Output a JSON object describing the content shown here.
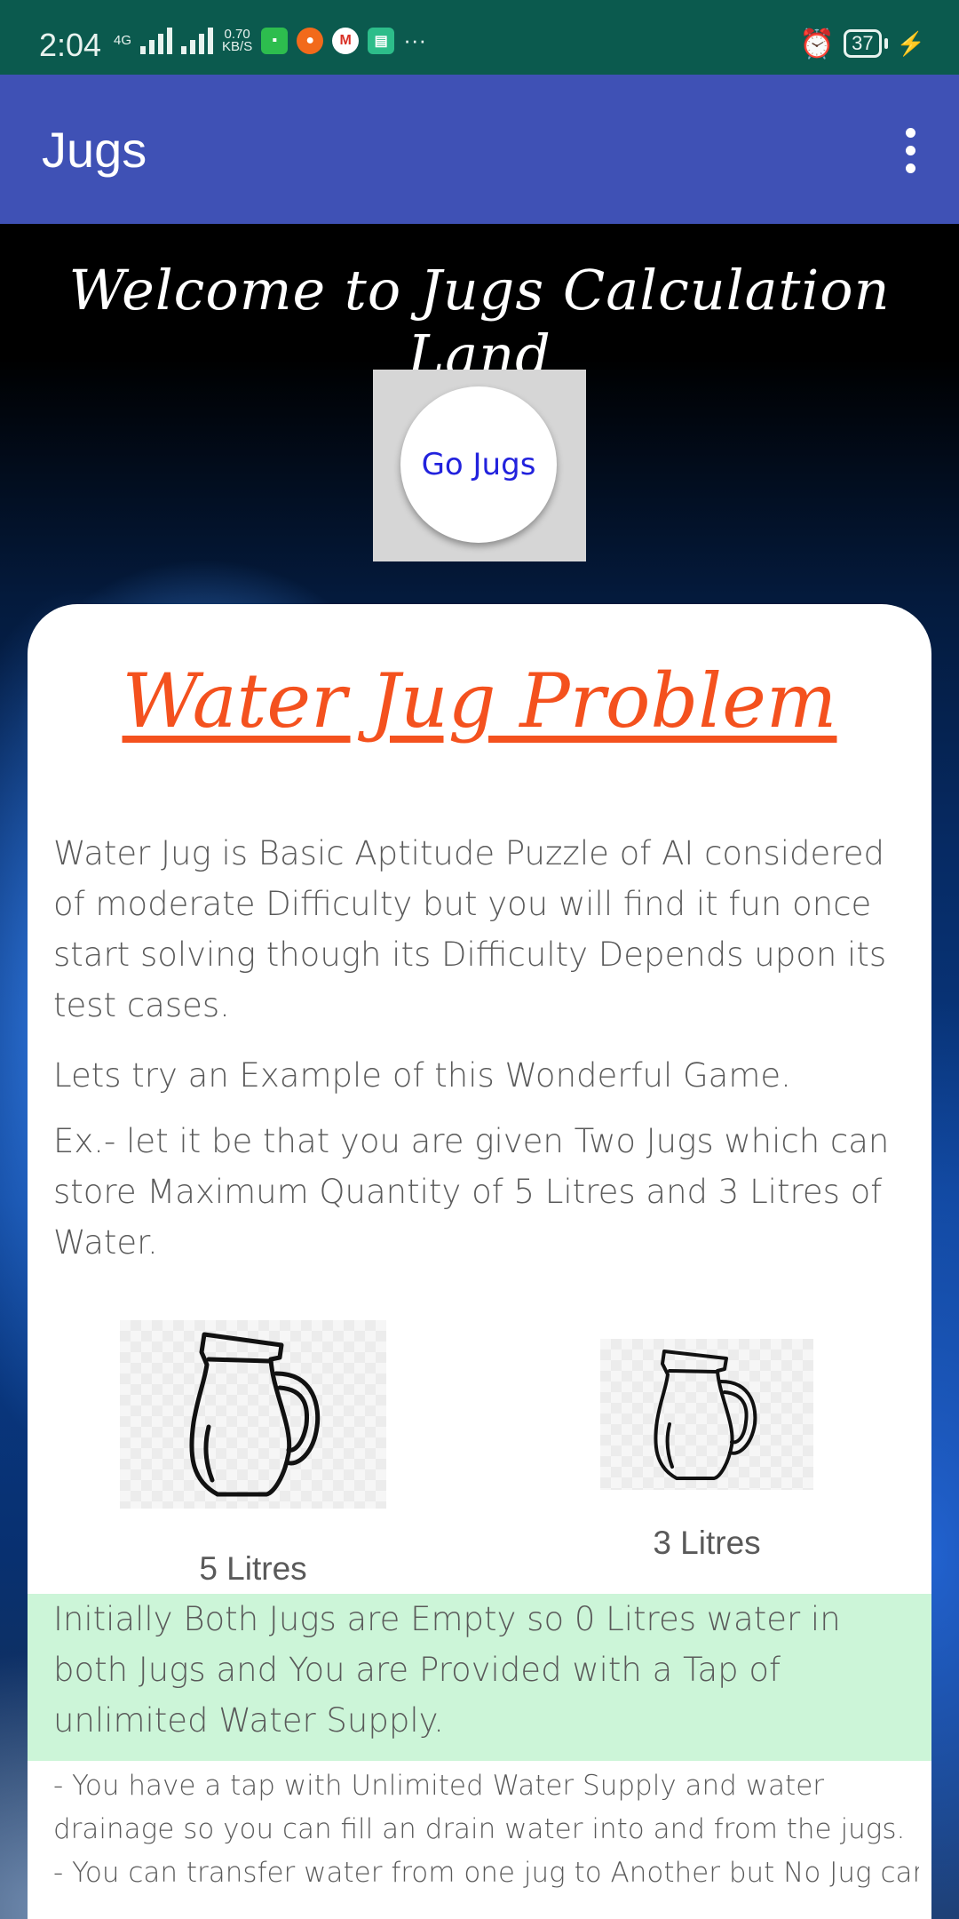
{
  "status_bar": {
    "time": "2:04",
    "network_type": "4G",
    "data_speed_value": "0.70",
    "data_speed_unit": "KB/S",
    "more": "···",
    "battery_level": "37"
  },
  "app_bar": {
    "title": "Jugs"
  },
  "welcome_text": "Welcome to Jugs Calculation Land",
  "go_button_label": "Go Jugs",
  "card": {
    "title": "Water Jug Problem",
    "paragraph_1": "Water Jug is Basic Aptitude Puzzle of AI considered of moderate Difficulty but you will find it fun once start solving though its Difficulty Depends upon its test cases.",
    "paragraph_2": "Lets try an Example of this Wonderful Game.",
    "paragraph_3": "Ex.- let it be that you are given Two Jugs which can store Maximum Quantity of 5 Litres and 3 Litres of Water.",
    "jug_big_label": "5 Litres",
    "jug_small_label": "3 Litres",
    "highlight_text": "Initially Both Jugs are Empty so 0 Litres water in both Jugs and You are Provided with a Tap of unlimited Water Supply.",
    "rule_1_line_1": "- You have a tap with Unlimited Water Supply and water",
    "rule_1_line_2": "drainage so you can fill an drain water into and from the jugs.",
    "rule_2_line_1": "- You can transfer water from one jug to Another but No Jug can"
  },
  "colors": {
    "status_bar": "#0b5a4e",
    "app_bar": "#3f51b5",
    "title_accent": "#f4511e",
    "highlight_bg": "#ccf5d8",
    "button_text": "#2222dd"
  }
}
